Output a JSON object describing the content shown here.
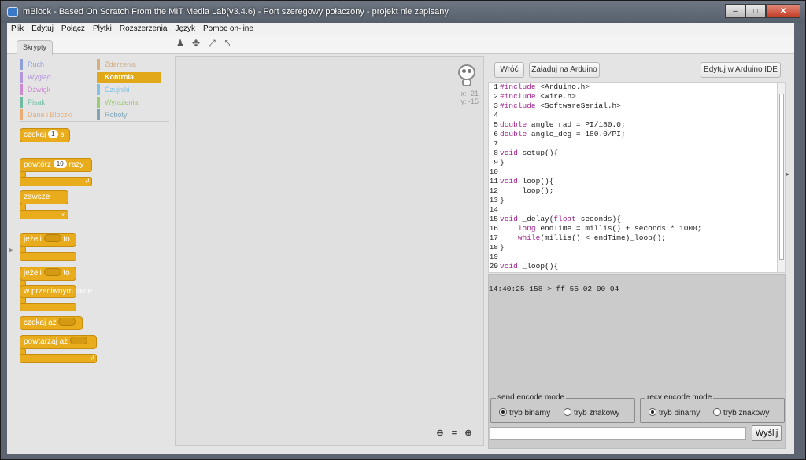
{
  "window": {
    "title": "mBlock - Based On Scratch From the MIT Media Lab(v3.4.6) - Port szeregowy połaczony - projekt nie zapisany"
  },
  "menu": [
    "Plik",
    "Edytuj",
    "Połącz",
    "Płytki",
    "Rozszerzenia",
    "Język",
    "Pomoc on-line"
  ],
  "tabs": {
    "scripts": "Skrypty"
  },
  "categories": [
    {
      "label": "Ruch",
      "color": "#4a6cd4",
      "selected": false
    },
    {
      "label": "Zdarzenia",
      "color": "#c88330",
      "selected": false
    },
    {
      "label": "Wygląd",
      "color": "#8a55d7",
      "selected": false
    },
    {
      "label": "Kontrola",
      "color": "#e1a91a",
      "selected": true
    },
    {
      "label": "Dźwięk",
      "color": "#bb42c3",
      "selected": false
    },
    {
      "label": "Czujniki",
      "color": "#2ca5e2",
      "selected": false
    },
    {
      "label": "Pisak",
      "color": "#0e9a6c",
      "selected": false
    },
    {
      "label": "Wyrażenia",
      "color": "#5cb712",
      "selected": false
    },
    {
      "label": "Dane i Bloczki",
      "color": "#ee7d16",
      "selected": false
    },
    {
      "label": "Roboty",
      "color": "#2a6f8c",
      "selected": false
    }
  ],
  "blocks": {
    "wait": {
      "text": "czekaj",
      "value": "1",
      "unit": "s"
    },
    "repeat": {
      "text": "powtórz",
      "value": "10",
      "unit": "razy"
    },
    "forever": {
      "text": "zawsze"
    },
    "if_then": {
      "text": "jeżeli",
      "then": "to"
    },
    "if_else": {
      "text": "jeżeli",
      "then": "to",
      "else": "w przeciwnym razie"
    },
    "wait_until": {
      "text": "czekaj aż"
    },
    "repeat_until": {
      "text": "powtarzaj aż"
    }
  },
  "sprite": {
    "x_label": "x: -21",
    "y_label": "y: -15"
  },
  "buttons": {
    "back": "Wróć",
    "upload": "Załaduj na Arduino",
    "edit_ide": "Edytuj w Arduino IDE",
    "send": "Wyślij"
  },
  "code_lines": [
    "#include <Arduino.h>",
    "#include <Wire.h>",
    "#include <SoftwareSerial.h>",
    "",
    "double angle_rad = PI/180.0;",
    "double angle_deg = 180.0/PI;",
    "",
    "void setup(){",
    "}",
    "",
    "void loop(){",
    "    _loop();",
    "}",
    "",
    "void _delay(float seconds){",
    "    long endTime = millis() + seconds * 1000;",
    "    while(millis() < endTime)_loop();",
    "}",
    "",
    "void _loop(){",
    "}"
  ],
  "serial": {
    "output": "14:40:25.158 > ff 55 02 00 04"
  },
  "send_mode": {
    "legend": "send encode mode",
    "binary": "tryb binarny",
    "text": "tryb znakowy",
    "selected": "binary"
  },
  "recv_mode": {
    "legend": "recv encode mode",
    "binary": "tryb binarny",
    "text": "tryb znakowy",
    "selected": "binary"
  },
  "send_input": {
    "value": ""
  }
}
